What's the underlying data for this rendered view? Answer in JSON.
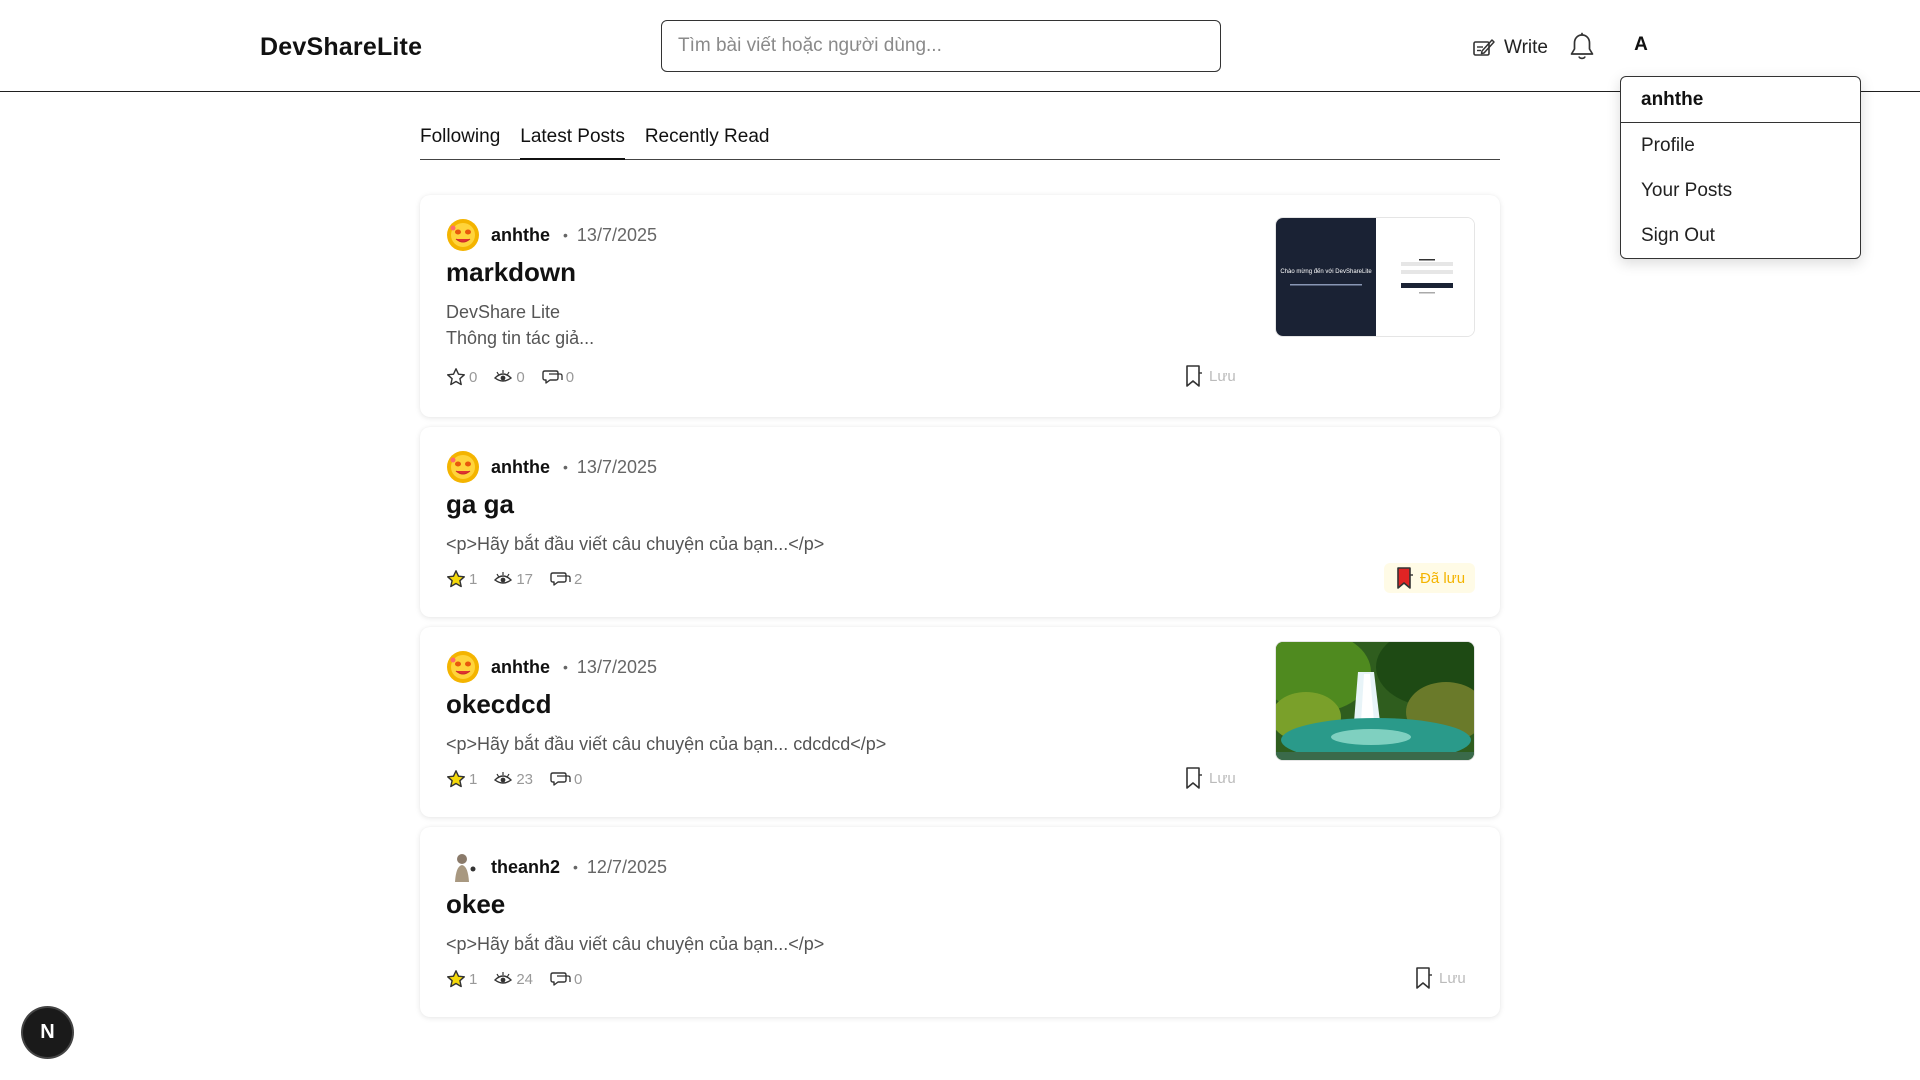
{
  "app": {
    "logo": "DevShareLite"
  },
  "search": {
    "placeholder": "Tìm bài viết hoặc người dùng..."
  },
  "header": {
    "write_label": "Write",
    "user_initial": "A"
  },
  "user_menu": {
    "username": "anhthe",
    "items": [
      "Profile",
      "Your Posts",
      "Sign Out"
    ]
  },
  "tabs": [
    {
      "label": "Following",
      "active": false
    },
    {
      "label": "Latest Posts",
      "active": true
    },
    {
      "label": "Recently Read",
      "active": false
    }
  ],
  "posts": [
    {
      "author": "anhthe",
      "date": "13/7/2025",
      "title": "markdown",
      "excerpt": [
        "DevShare Lite",
        "Thông tin tác giả..."
      ],
      "stars": "0",
      "views": "0",
      "comments": "0",
      "starred": false,
      "save_label": "Lưu",
      "saved": false,
      "thumbnail": "screenshot",
      "avatar": "emoji"
    },
    {
      "author": "anhthe",
      "date": "13/7/2025",
      "title": "ga ga",
      "excerpt": [
        "<p>Hãy bắt đầu viết câu chuyện của bạn...</p>"
      ],
      "stars": "1",
      "views": "17",
      "comments": "2",
      "starred": true,
      "save_label": "Đã lưu",
      "saved": true,
      "thumbnail": null,
      "avatar": "emoji"
    },
    {
      "author": "anhthe",
      "date": "13/7/2025",
      "title": "okecdcd",
      "excerpt": [
        "<p>Hãy bắt đầu viết câu chuyện của bạn... cdcdcd</p>"
      ],
      "stars": "1",
      "views": "23",
      "comments": "0",
      "starred": true,
      "save_label": "Lưu",
      "saved": false,
      "thumbnail": "waterfall",
      "avatar": "emoji"
    },
    {
      "author": "theanh2",
      "date": "12/7/2025",
      "title": "okee",
      "excerpt": [
        "<p>Hãy bắt đầu viết câu chuyện của bạn...</p>"
      ],
      "stars": "1",
      "views": "24",
      "comments": "0",
      "starred": true,
      "save_label": "Lưu",
      "saved": false,
      "thumbnail": null,
      "avatar": "figure"
    }
  ],
  "thumbnail_text": {
    "screenshot_heading": "Chào mừng đến với DevShareLite"
  },
  "badge": {
    "label": "N"
  },
  "colors": {
    "star_fill": "#f5d90a",
    "saved_bookmark": "#e02424",
    "saved_text": "#f4b400"
  }
}
